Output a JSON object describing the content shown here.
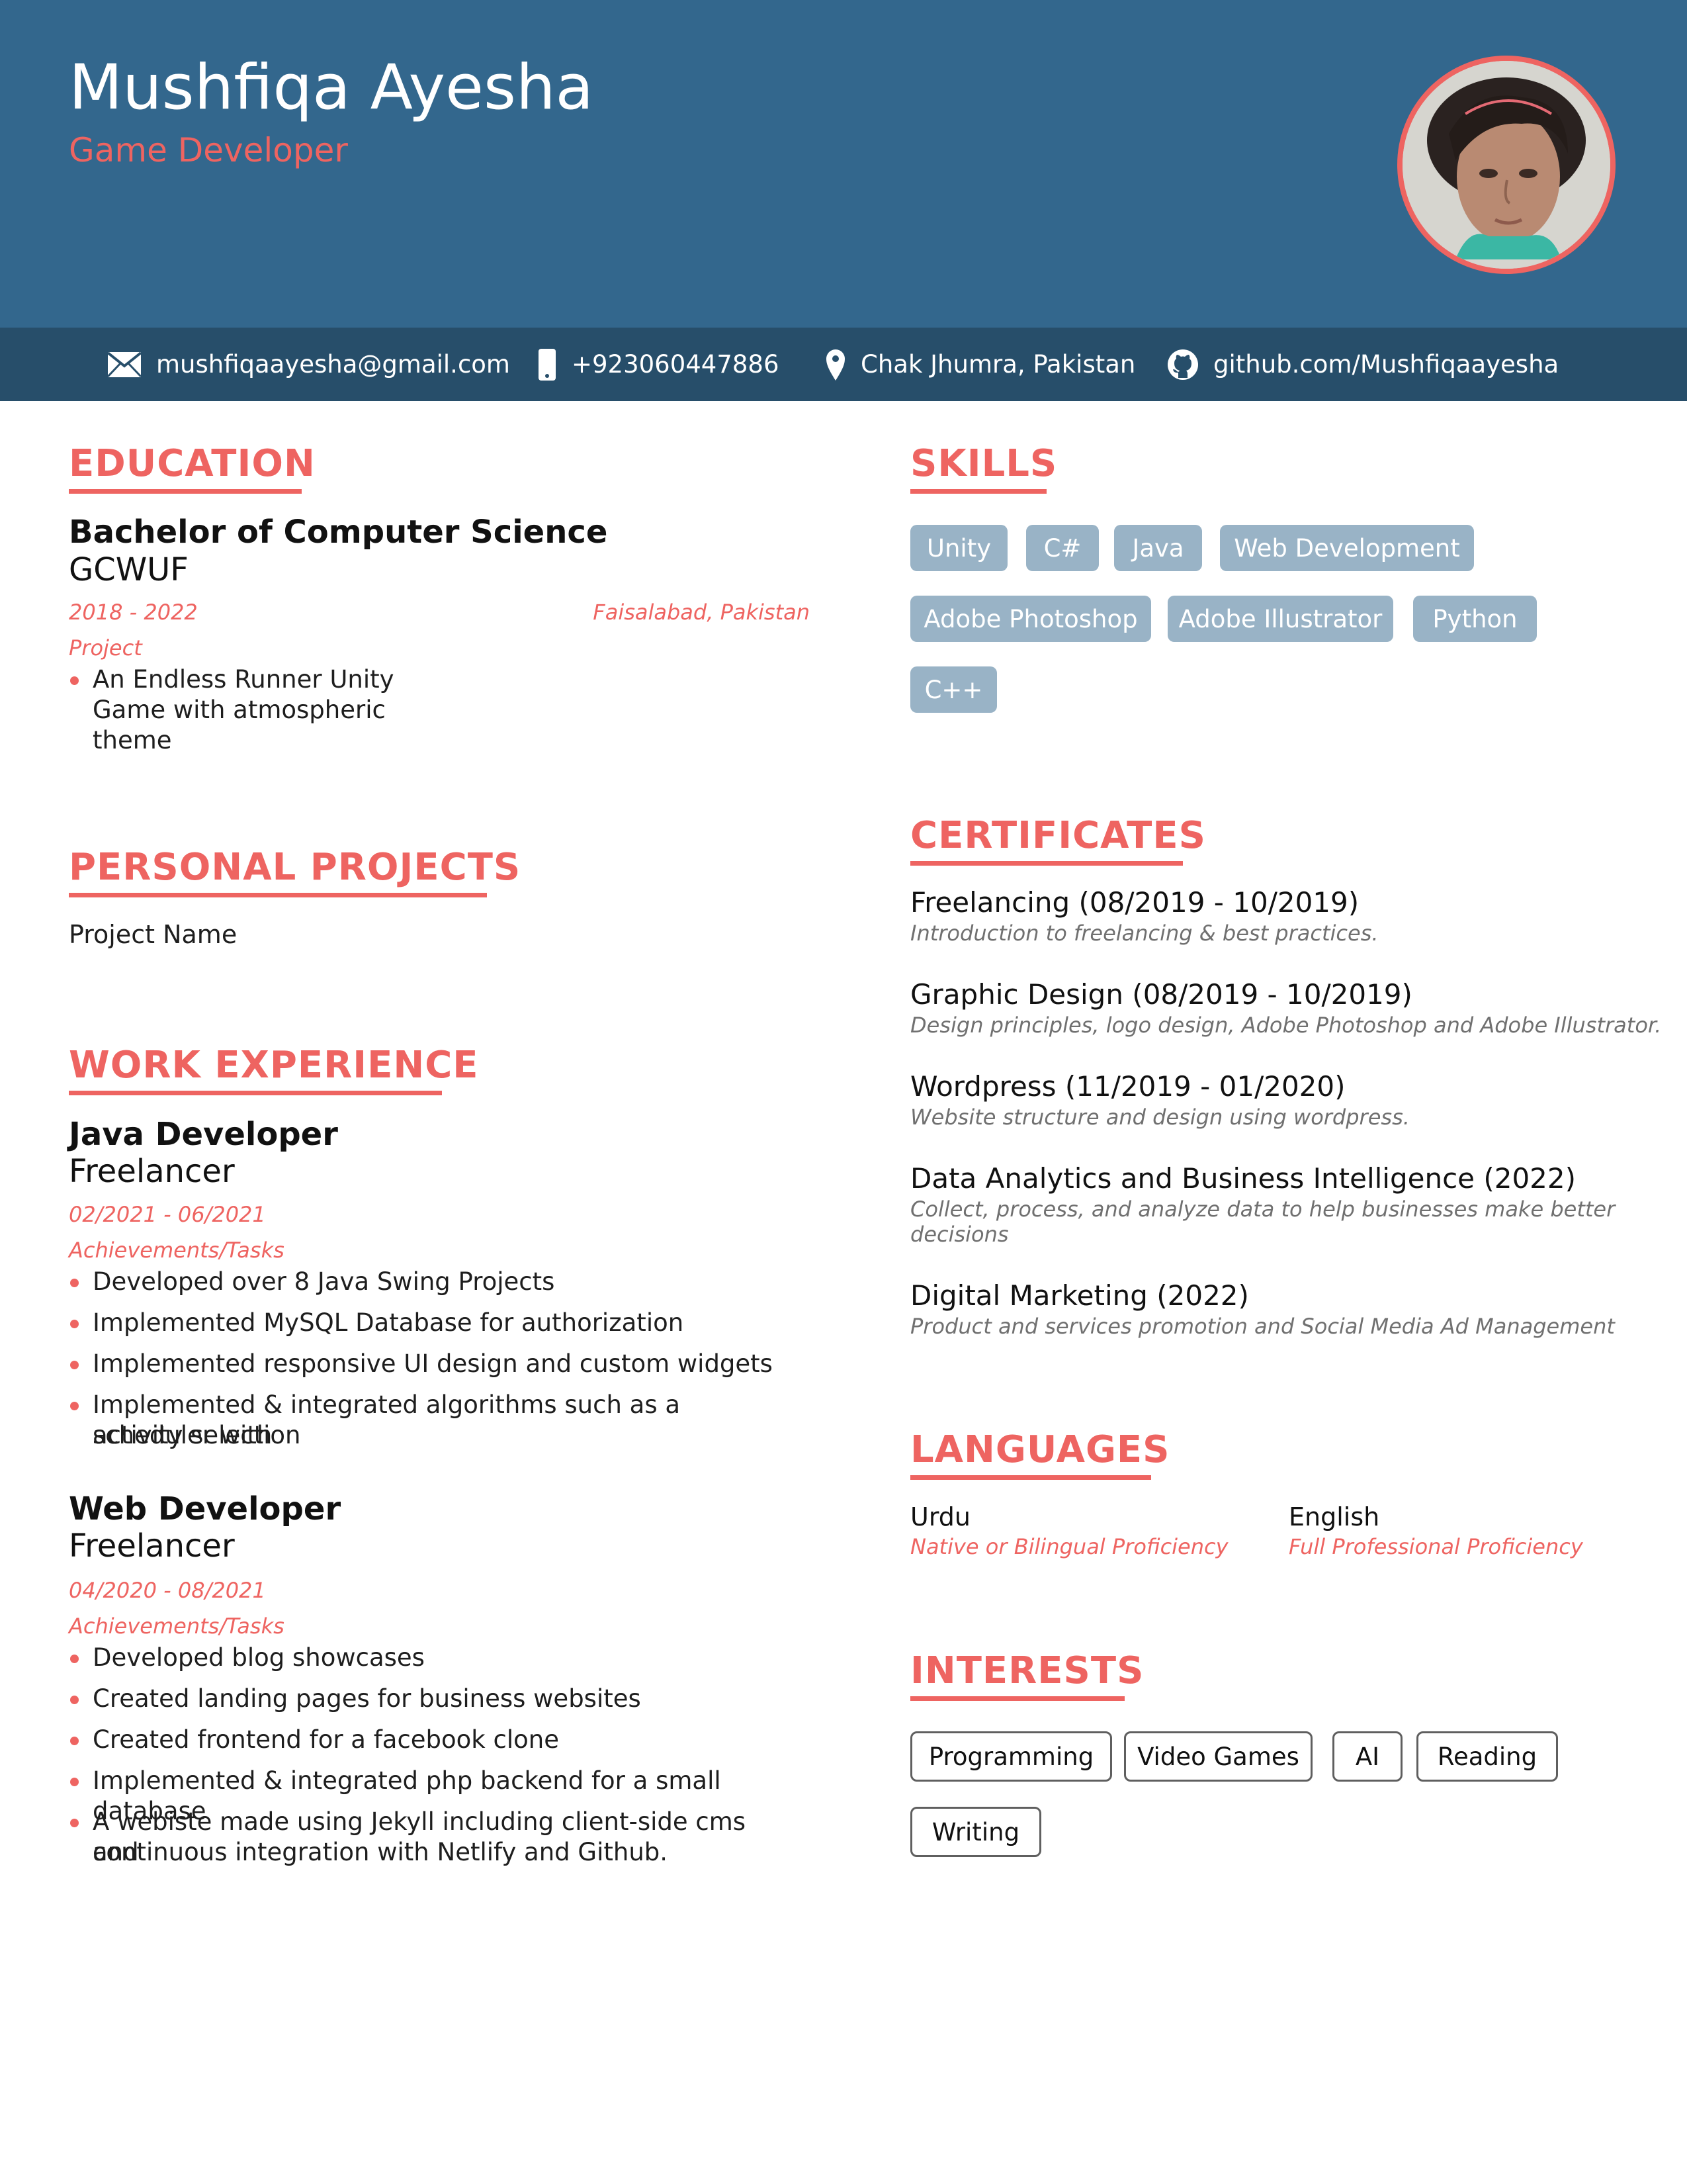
{
  "header": {
    "name": "Mushfiqa Ayesha",
    "role": "Game Developer",
    "colors": {
      "header_bg": "#33678d",
      "contact_bg": "#274e6a",
      "accent": "#ee6461",
      "chip_bg": "#99b3c6"
    }
  },
  "contact": {
    "email": "mushfiqaayesha@gmail.com",
    "phone": "+923060447886",
    "location": "Chak Jhumra, Pakistan",
    "github": "github.com/Mushfiqaayesha",
    "icons": [
      "envelope-icon",
      "phone-icon",
      "map-pin-icon",
      "github-icon"
    ]
  },
  "education": {
    "title": "EDUCATION",
    "degree": "Bachelor of Computer Science",
    "school": "GCWUF",
    "dates": "2018 - 2022",
    "location": "Faisalabad, Pakistan",
    "project_label": "Project",
    "project_lines": [
      "An Endless Runner Unity",
      "Game with atmospheric",
      "theme"
    ]
  },
  "personal_projects": {
    "title": "PERSONAL PROJECTS",
    "item": "Project Name"
  },
  "work": {
    "title": "WORK EXPERIENCE",
    "jobs": [
      {
        "title": "Java Developer",
        "company": "Freelancer",
        "dates": "02/2021 - 06/2021",
        "label": "Achievements/Tasks",
        "tasks": [
          "Developed over 8 Java Swing Projects",
          "Implemented MySQL Database for authorization",
          "Implemented responsive UI design and custom widgets",
          "Implemented & integrated algorithms such as a scheduler with",
          "activity selection"
        ]
      },
      {
        "title": "Web Developer",
        "company": "Freelancer",
        "dates": "04/2020 - 08/2021",
        "label": "Achievements/Tasks",
        "tasks": [
          "Developed blog showcases",
          "Created landing pages for business websites",
          "Created frontend for a facebook clone",
          "Implemented & integrated php backend for a small database",
          "A webiste made using Jekyll including client-side cms and",
          "continuous integration with Netlify and Github."
        ]
      }
    ]
  },
  "skills": {
    "title": "SKILLS",
    "items": [
      "Unity",
      "C#",
      "Java",
      "Web Development",
      "Adobe Photoshop",
      "Adobe Illustrator",
      "Python",
      "C++"
    ]
  },
  "certificates": {
    "title": "CERTIFICATES",
    "items": [
      {
        "name": "Freelancing (08/2019 - 10/2019)",
        "desc": "Introduction to freelancing & best practices."
      },
      {
        "name": "Graphic Design (08/2019 - 10/2019)",
        "desc": "Design principles, logo design, Adobe Photoshop and Adobe Illustrator."
      },
      {
        "name": "Wordpress (11/2019 - 01/2020)",
        "desc": "Website structure and design using wordpress."
      },
      {
        "name": "Data Analytics and Business Intelligence (2022)",
        "desc": "Collect, process, and analyze data to help businesses make better",
        "desc2": "decisions"
      },
      {
        "name": "Digital Marketing (2022)",
        "desc": "Product and services promotion and Social Media Ad Management"
      }
    ]
  },
  "languages": {
    "title": "LANGUAGES",
    "items": [
      {
        "name": "Urdu",
        "level": "Native or Bilingual Proficiency"
      },
      {
        "name": "English",
        "level": "Full Professional Proficiency"
      }
    ]
  },
  "interests": {
    "title": "INTERESTS",
    "items": [
      "Programming",
      "Video Games",
      "AI",
      "Reading",
      "Writing"
    ]
  }
}
